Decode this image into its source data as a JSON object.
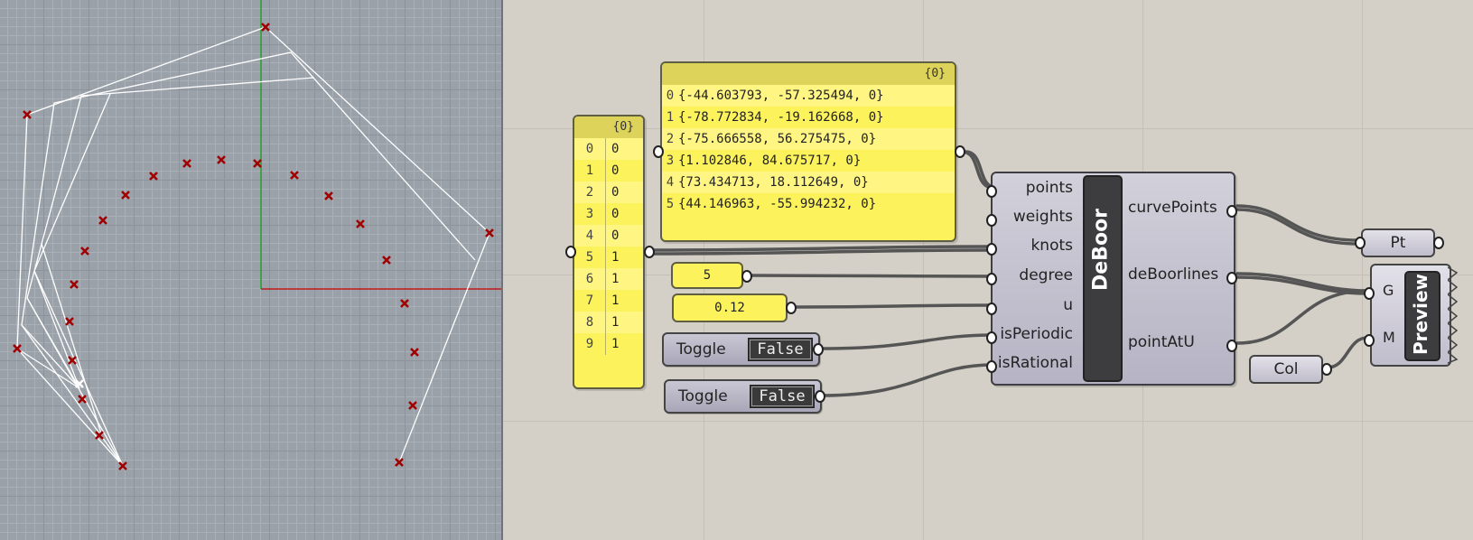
{
  "viewport": {
    "background": "#9ba1a9",
    "axis_x_color": "#c00000",
    "axis_y_color": "#00a000",
    "control_point_color": "#a00000",
    "icon": "cross-marker"
  },
  "panels": {
    "points_panel": {
      "header": "{0}",
      "rows": [
        {
          "index": "0",
          "value": "{-44.603793, -57.325494, 0}"
        },
        {
          "index": "1",
          "value": "{-78.772834, -19.162668, 0}"
        },
        {
          "index": "2",
          "value": "{-75.666558, 56.275475, 0}"
        },
        {
          "index": "3",
          "value": "{1.102846, 84.675717, 0}"
        },
        {
          "index": "4",
          "value": "{73.434713, 18.112649, 0}"
        },
        {
          "index": "5",
          "value": "{44.146963, -55.994232, 0}"
        }
      ]
    },
    "knots_panel": {
      "header": "{0}",
      "rows": [
        {
          "index": "0",
          "value": "0"
        },
        {
          "index": "1",
          "value": "0"
        },
        {
          "index": "2",
          "value": "0"
        },
        {
          "index": "3",
          "value": "0"
        },
        {
          "index": "4",
          "value": "0"
        },
        {
          "index": "5",
          "value": "1"
        },
        {
          "index": "6",
          "value": "1"
        },
        {
          "index": "7",
          "value": "1"
        },
        {
          "index": "8",
          "value": "1"
        },
        {
          "index": "9",
          "value": "1"
        }
      ]
    }
  },
  "sliders": {
    "degree_value": "5",
    "u_value": "0.12"
  },
  "toggles": {
    "periodic": {
      "label": "Toggle",
      "value": "False"
    },
    "rational": {
      "label": "Toggle",
      "value": "False"
    }
  },
  "deboor": {
    "title": "DeBoor",
    "inputs": [
      "points",
      "weights",
      "knots",
      "degree",
      "u",
      "isPeriodic",
      "isRational"
    ],
    "outputs": [
      "curvePoints",
      "deBoorlines",
      "pointAtU"
    ]
  },
  "pt_component": {
    "label": "Pt"
  },
  "col_component": {
    "label": "Col"
  },
  "preview": {
    "title": "Preview",
    "inputs": [
      "G",
      "M"
    ]
  },
  "colors": {
    "panel_yellow": "#fbf25c",
    "canvas": "#d4d0c8",
    "wire": "#555555"
  }
}
